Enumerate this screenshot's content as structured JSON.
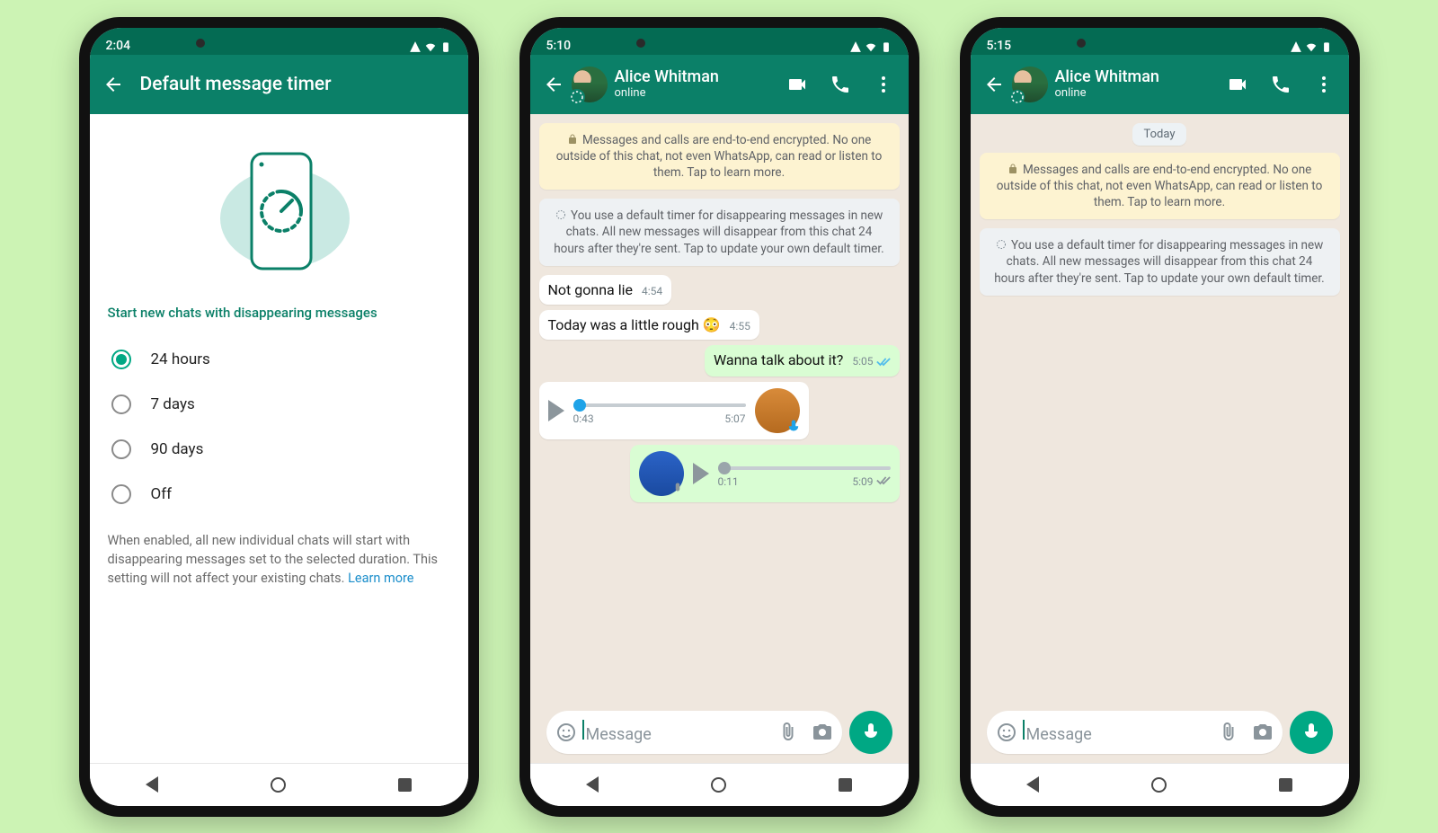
{
  "phones": {
    "settings": {
      "status_time": "2:04",
      "header_title": "Default message timer",
      "subhead": "Start new chats with disappearing messages",
      "options": [
        "24 hours",
        "7 days",
        "90 days",
        "Off"
      ],
      "selected_index": 0,
      "explain": "When enabled, all new individual chats will start with disappearing messages set to the selected duration. This setting will not affect your existing chats.",
      "learn_more": "Learn more"
    },
    "chat1": {
      "status_time": "5:10",
      "contact_name": "Alice Whitman",
      "contact_status": "online",
      "encryption_banner": "Messages and calls are end-to-end encrypted. No one outside of this chat, not even WhatsApp, can read or listen to them. Tap to learn more.",
      "timer_banner": "You use a default timer for disappearing messages in new chats. All new messages will disappear from this chat 24 hours after they're sent. Tap to update your own default timer.",
      "messages": [
        {
          "side": "in",
          "text": "Not gonna lie",
          "time": "4:54"
        },
        {
          "side": "in",
          "text": "Today was a little rough 😳",
          "time": "4:55"
        },
        {
          "side": "out",
          "text": "Wanna talk about it?",
          "time": "5:05",
          "ticks": true
        }
      ],
      "voice_in": {
        "duration": "0:43",
        "time": "5:07"
      },
      "voice_out": {
        "duration": "0:11",
        "time": "5:09"
      },
      "composer_placeholder": "Message"
    },
    "chat2": {
      "status_time": "5:15",
      "contact_name": "Alice Whitman",
      "contact_status": "online",
      "day_label": "Today",
      "encryption_banner": "Messages and calls are end-to-end encrypted. No one outside of this chat, not even WhatsApp, can read or listen to them. Tap to learn more.",
      "timer_banner": "You use a default timer for disappearing messages in new chats. All new messages will disappear from this chat 24 hours after they're sent. Tap to update your own default timer.",
      "composer_placeholder": "Message"
    }
  }
}
